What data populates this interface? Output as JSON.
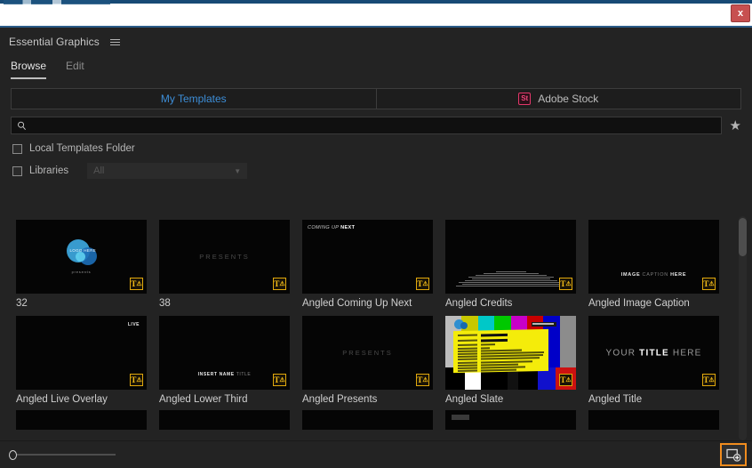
{
  "window": {
    "close_label": "x",
    "close_icon": "close-icon"
  },
  "panel": {
    "title": "Essential Graphics",
    "menu_icon": "hamburger-menu-icon",
    "tabs": [
      {
        "label": "Browse",
        "active": true
      },
      {
        "label": "Edit",
        "active": false
      }
    ]
  },
  "source_toggle": {
    "my_templates": "My Templates",
    "adobe_stock": "Adobe Stock",
    "adobe_stock_badge": "St",
    "accent_blue": "#3d8ed8",
    "stock_red": "#e2376a"
  },
  "search": {
    "icon": "search-icon",
    "value": "",
    "placeholder": "",
    "favorite_icon": "star-icon"
  },
  "filters": {
    "local_templates": {
      "label": "Local Templates Folder",
      "checked": false
    },
    "libraries": {
      "label": "Libraries",
      "checked": false
    },
    "libraries_select": {
      "value": "All",
      "caret_icon": "chevron-down-icon"
    }
  },
  "grid": {
    "badge_text": "T",
    "badge_warn": "⚠",
    "items": [
      {
        "label": "32",
        "art": "logo-presents"
      },
      {
        "label": "38",
        "art": "presents"
      },
      {
        "label": "Angled Coming Up Next",
        "art": "coming-up-next"
      },
      {
        "label": "Angled Credits",
        "art": "credits"
      },
      {
        "label": "Angled Image Caption",
        "art": "image-caption"
      },
      {
        "label": "Angled Live Overlay",
        "art": "live-overlay"
      },
      {
        "label": "Angled Lower Third",
        "art": "lower-third"
      },
      {
        "label": "Angled Presents",
        "art": "presents"
      },
      {
        "label": "Angled Slate",
        "art": "slate-bars"
      },
      {
        "label": "Angled Title",
        "art": "title"
      }
    ],
    "art_text": {
      "logo_name": "LOGO HERE",
      "logo_presents": "presents",
      "presents": "PRESENTS",
      "coming_up": "COMING UP ",
      "coming_up_bold": "NEXT",
      "live": "LIVE",
      "caption_a": "IMAGE ",
      "caption_b": "CAPTION ",
      "caption_c": "HERE",
      "lower_a": "INSERT NAME ",
      "lower_b": "TITLE",
      "title_a": "YOUR ",
      "title_b": "TITLE",
      "title_c": " HERE"
    }
  },
  "footer": {
    "zoom_slider_name": "thumbnail-size-slider",
    "new_layer_icon": "new-item-icon",
    "new_layer_highlight": "#f08c1e"
  },
  "scrollbar": {
    "name": "templates-scrollbar"
  }
}
